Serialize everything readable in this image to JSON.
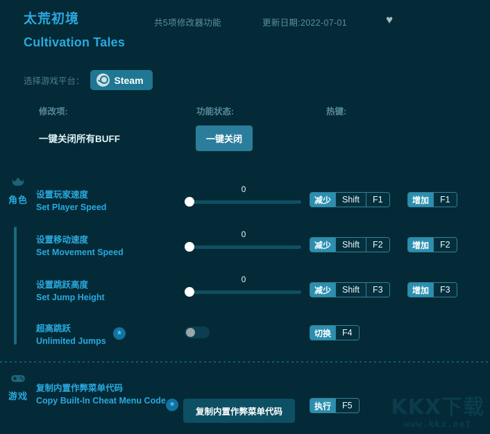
{
  "header": {
    "title_cn": "太荒初境",
    "title_en": "Cultivation Tales",
    "feature_count_text": "共5项修改器功能",
    "update_date_text": "更新日期:2022-07-01",
    "favorite_icon": "heart-icon",
    "favorite_glyph": "♥"
  },
  "platform": {
    "label": "选择游戏平台：",
    "selected": "Steam",
    "icon": "steam-icon"
  },
  "columns": {
    "mod": "修改项:",
    "state": "功能状态:",
    "hotkey": "热键:"
  },
  "top_action": {
    "label": "一键关闭所有BUFF",
    "button": "一键关闭"
  },
  "sections": [
    {
      "id": "character",
      "name": "角色",
      "icon": "person-icon",
      "rows": [
        {
          "name_cn": "设置玩家速度",
          "name_en": "Set Player Speed",
          "control": "slider",
          "value": "0",
          "premium": false,
          "hotkeys": [
            {
              "action": "减少",
              "keys": [
                "Shift",
                "F1"
              ]
            },
            {
              "action": "增加",
              "keys": [
                "F1"
              ]
            }
          ]
        },
        {
          "name_cn": "设置移动速度",
          "name_en": "Set Movement Speed",
          "control": "slider",
          "value": "0",
          "premium": false,
          "hotkeys": [
            {
              "action": "减少",
              "keys": [
                "Shift",
                "F2"
              ]
            },
            {
              "action": "增加",
              "keys": [
                "F2"
              ]
            }
          ]
        },
        {
          "name_cn": "设置跳跃高度",
          "name_en": "Set Jump Height",
          "control": "slider",
          "value": "0",
          "premium": false,
          "hotkeys": [
            {
              "action": "减少",
              "keys": [
                "Shift",
                "F3"
              ]
            },
            {
              "action": "增加",
              "keys": [
                "F3"
              ]
            }
          ]
        },
        {
          "name_cn": "超高跳跃",
          "name_en": "Unlimited Jumps",
          "control": "toggle",
          "value": "off",
          "premium": true,
          "premium_glyph": "★",
          "hotkeys": [
            {
              "action": "切换",
              "keys": [
                "F4"
              ]
            }
          ]
        }
      ]
    },
    {
      "id": "game",
      "name": "游戏",
      "icon": "gamepad-icon",
      "rows": [
        {
          "name_cn": "复制内置作弊菜单代码",
          "name_en": "Copy Built-In Cheat Menu Code",
          "control": "button",
          "button_label": "复制内置作弊菜单代码",
          "premium": true,
          "premium_glyph": "★",
          "hotkeys": [
            {
              "action": "执行",
              "keys": [
                "F5"
              ]
            }
          ]
        }
      ]
    }
  ],
  "watermark": {
    "main": "KKX下载",
    "sub": "www.kkx.net"
  },
  "colors": {
    "background": "#032a36",
    "accent": "#2aa9e0",
    "button": "#2b7d9c",
    "hotkey_action": "#2b8fb0",
    "muted_text": "#56899a"
  }
}
